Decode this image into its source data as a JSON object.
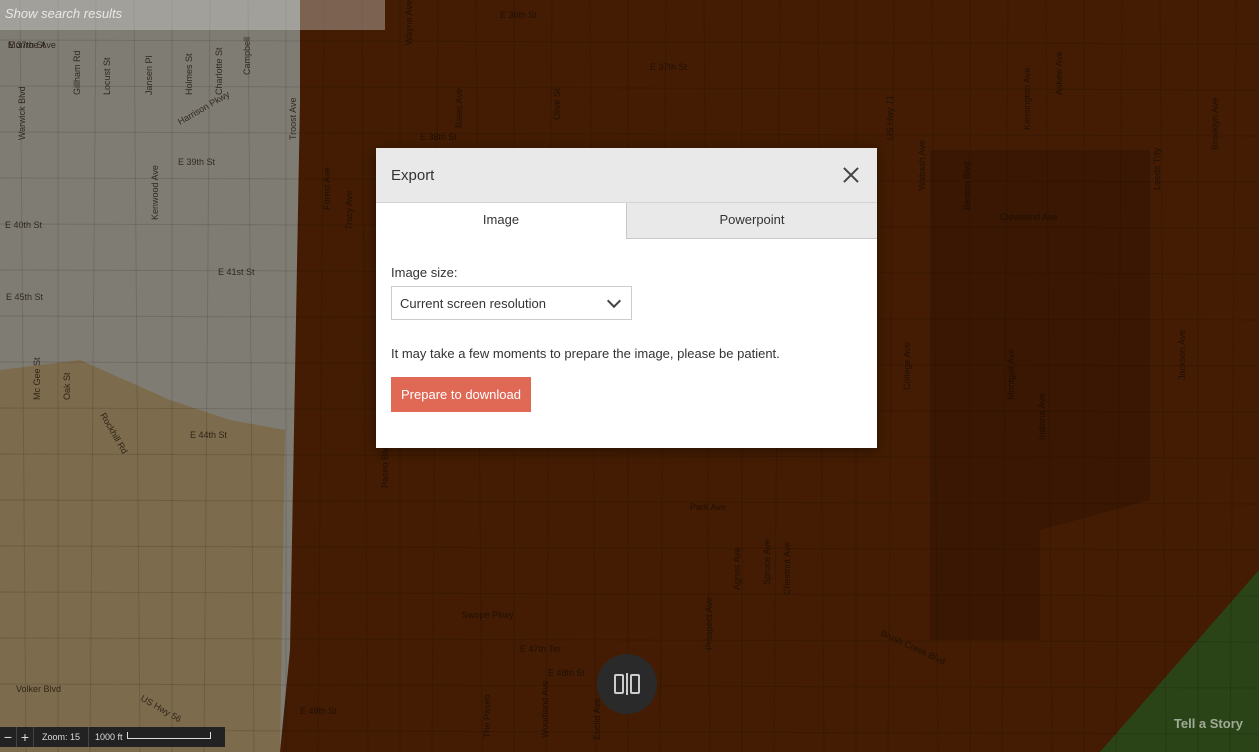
{
  "search": {
    "show_results": "Show search results"
  },
  "export_modal": {
    "title": "Export",
    "tabs": [
      {
        "label": "Image"
      },
      {
        "label": "Powerpoint"
      }
    ],
    "active_tab": "Image",
    "image_size_label": "Image size:",
    "image_size_value": "Current screen resolution",
    "note": "It may take a few moments to prepare the image, please be patient.",
    "prepare_button": "Prepare to download",
    "accent_color": "#e06956"
  },
  "map_controls": {
    "zoom_out": "−",
    "zoom_in": "+",
    "zoom_label": "Zoom: 15",
    "scale_label": "1000 ft"
  },
  "tell_a_story": "Tell a Story",
  "map_labels": [
    "E 37th St",
    "Gillham Rd",
    "Locust St",
    "Jansen Pl",
    "Holmes St",
    "Charlotte St",
    "Campbell",
    "Harrison Pkwy",
    "Warwick Blvd",
    "E 39th St",
    "E 40th St",
    "E 41st St",
    "Kenwood Ave",
    "Forest Ave",
    "Tracy Ave",
    "Troost Ave",
    "E 36th St",
    "E 37th St",
    "E 38th St",
    "E 45th St",
    "Oak St",
    "Mc Gee St",
    "Rockhill Rd",
    "E 44th St",
    "Swope Pkwy",
    "E 47th Ter",
    "E 48th St",
    "E 49th St",
    "Volker Blvd",
    "US Hwy 56",
    "Brush Creek Blvd",
    "Prospect Ave",
    "College Ave",
    "Indiana Ave",
    "Cleveland Ave",
    "Leeds Trfy",
    "Jackson Ave",
    "Spruce Ave",
    "Chestnut Ave",
    "Agnes Ave",
    "Montgall Ave",
    "Wabash Ave",
    "Park Ave",
    "Olive St",
    "US Hwy 71",
    "Benton Blvd",
    "Bales Ave",
    "Wayne Ave",
    "Paseo Blvd",
    "The Paseo",
    "Woodland Ave",
    "Euclid Ave",
    "Brooklyn Ave",
    "Kensington Ave",
    "Askew Ave",
    "Monroe Ave"
  ],
  "map_colors": {
    "base": "#7a3406",
    "light": "#e8e2d2",
    "tan": "#e2c48a",
    "dark": "#5c2604",
    "park": "#4e7a2a"
  }
}
